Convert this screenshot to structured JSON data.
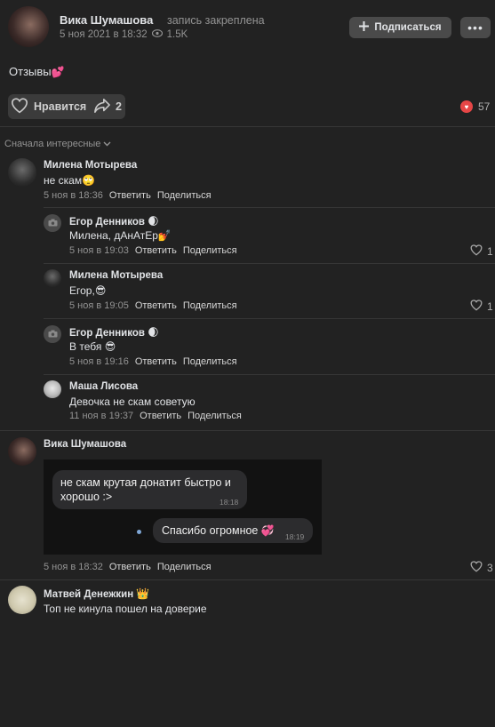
{
  "post": {
    "author": "Вика Шумашова",
    "pinned_label": "запись закреплена",
    "date": "5 ноя 2021 в 18:32",
    "views": "1.5K",
    "subscribe_label": "Подписаться",
    "more_label": "•••",
    "text": "Отзывы",
    "text_emoji": "💕",
    "like_label": "Нравится",
    "shares": "2",
    "likes_total": "57"
  },
  "sort_label": "Сначала интересные",
  "comments": [
    {
      "name": "Милена Мотырева",
      "text": "не скам",
      "emoji": "🙄",
      "date": "5 ноя в 18:36",
      "reply": "Ответить",
      "share": "Поделиться"
    },
    {
      "name": "Егор Денников",
      "name_emoji": "🌒",
      "text": "Милена, дАнАтЕр",
      "emoji": "💅",
      "date": "5 ноя в 19:03",
      "reply": "Ответить",
      "share": "Поделиться",
      "likes": "1"
    },
    {
      "name": "Милена Мотырева",
      "text": "Егор,",
      "emoji": "😎",
      "date": "5 ноя в 19:05",
      "reply": "Ответить",
      "share": "Поделиться",
      "likes": "1"
    },
    {
      "name": "Егор Денников",
      "name_emoji": "🌒",
      "text": "В тебя",
      "emoji": "😎",
      "date": "5 ноя в 19:16",
      "reply": "Ответить",
      "share": "Поделиться"
    },
    {
      "name": "Маша Лисова",
      "text": "Девочка не скам советую",
      "date": "11 ноя в 19:37",
      "reply": "Ответить",
      "share": "Поделиться"
    },
    {
      "name": "Вика Шумашова",
      "date": "5 ноя в 18:32",
      "reply": "Ответить",
      "share": "Поделиться",
      "likes": "3",
      "attachment": {
        "msg_in": "не скам крутая донатит быстро и хорошо :>",
        "time_in": "18:18",
        "msg_out": "Спасибо огромное",
        "msg_out_emoji": "💞",
        "time_out": "18:19"
      }
    },
    {
      "name": "Матвей Денежкин",
      "name_emoji": "👑",
      "text": "Топ не кинула пошел на доверие"
    }
  ],
  "colors": {
    "background": "#222222",
    "accent_heart": "#e64646",
    "text": "#e1e3e6",
    "muted": "#939393"
  }
}
